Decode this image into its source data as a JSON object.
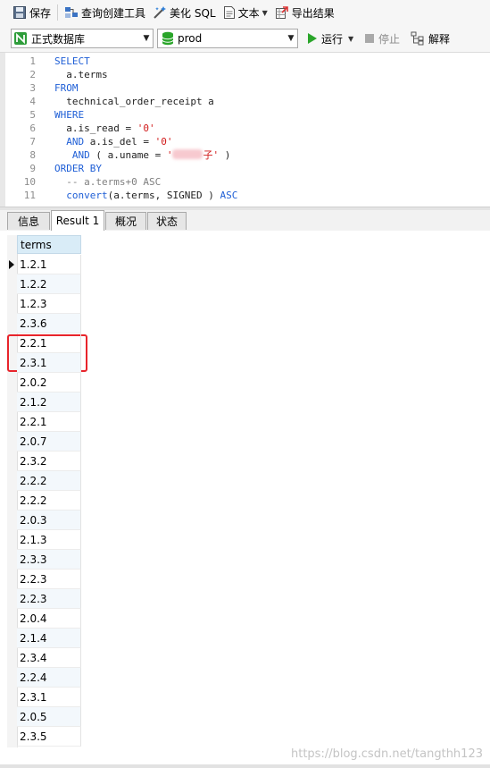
{
  "toolbar": {
    "save": "保存",
    "query_builder": "查询创建工具",
    "beautify": "美化 SQL",
    "text": "文本",
    "export": "导出结果"
  },
  "connection": {
    "database": "正式数据库",
    "schema": "prod",
    "run": "运行",
    "stop": "停止",
    "explain": "解释"
  },
  "editor": {
    "lines": [
      {
        "n": "1",
        "parts": [
          {
            "t": "SELECT",
            "c": "kw"
          }
        ]
      },
      {
        "n": "2",
        "parts": [
          {
            "t": "  a.terms",
            "c": "plain"
          }
        ]
      },
      {
        "n": "3",
        "parts": [
          {
            "t": "FROM",
            "c": "kw"
          }
        ]
      },
      {
        "n": "4",
        "parts": [
          {
            "t": "  technical_order_receipt a",
            "c": "plain"
          }
        ]
      },
      {
        "n": "5",
        "parts": [
          {
            "t": "WHERE",
            "c": "kw"
          }
        ]
      },
      {
        "n": "6",
        "parts": [
          {
            "t": "  a.is_read = ",
            "c": "plain"
          },
          {
            "t": "'0'",
            "c": "str"
          }
        ]
      },
      {
        "n": "7",
        "parts": [
          {
            "t": "  AND",
            "c": "kw"
          },
          {
            "t": " a.is_del = ",
            "c": "plain"
          },
          {
            "t": "'0'",
            "c": "str"
          }
        ]
      },
      {
        "n": "8",
        "parts": [
          {
            "t": "   AND",
            "c": "kw"
          },
          {
            "t": " ( a.uname = ",
            "c": "plain"
          },
          {
            "t": "'",
            "c": "str"
          },
          {
            "t": "",
            "c": "blur"
          },
          {
            "t": "子'",
            "c": "str"
          },
          {
            "t": " )",
            "c": "plain"
          }
        ]
      },
      {
        "n": "9",
        "parts": [
          {
            "t": "ORDER BY",
            "c": "kw"
          }
        ]
      },
      {
        "n": "10",
        "parts": [
          {
            "t": "  -- a.terms+0 ASC",
            "c": "cm"
          }
        ]
      },
      {
        "n": "11",
        "parts": [
          {
            "t": "  convert",
            "c": "kw"
          },
          {
            "t": "(a.terms, SIGNED ) ",
            "c": "plain"
          },
          {
            "t": "ASC",
            "c": "kw"
          }
        ]
      }
    ]
  },
  "tabs": [
    "信息",
    "Result 1",
    "概况",
    "状态"
  ],
  "result": {
    "column": "terms",
    "rows": [
      "1.2.1",
      "1.2.2",
      "1.2.3",
      "2.3.6",
      "2.2.1",
      "2.3.1",
      "2.0.2",
      "2.1.2",
      "2.2.1",
      "2.0.7",
      "2.3.2",
      "2.2.2",
      "2.2.2",
      "2.0.3",
      "2.1.3",
      "2.3.3",
      "2.2.3",
      "2.2.3",
      "2.0.4",
      "2.1.4",
      "2.3.4",
      "2.2.4",
      "2.3.1",
      "2.0.5",
      "2.3.5"
    ]
  },
  "watermark": "https://blog.csdn.net/tangthh123",
  "colors": {
    "keyword": "#1f5fd6",
    "string": "#d11a1a",
    "highlight_box": "#e8242b",
    "run_green": "#2aa52a"
  }
}
